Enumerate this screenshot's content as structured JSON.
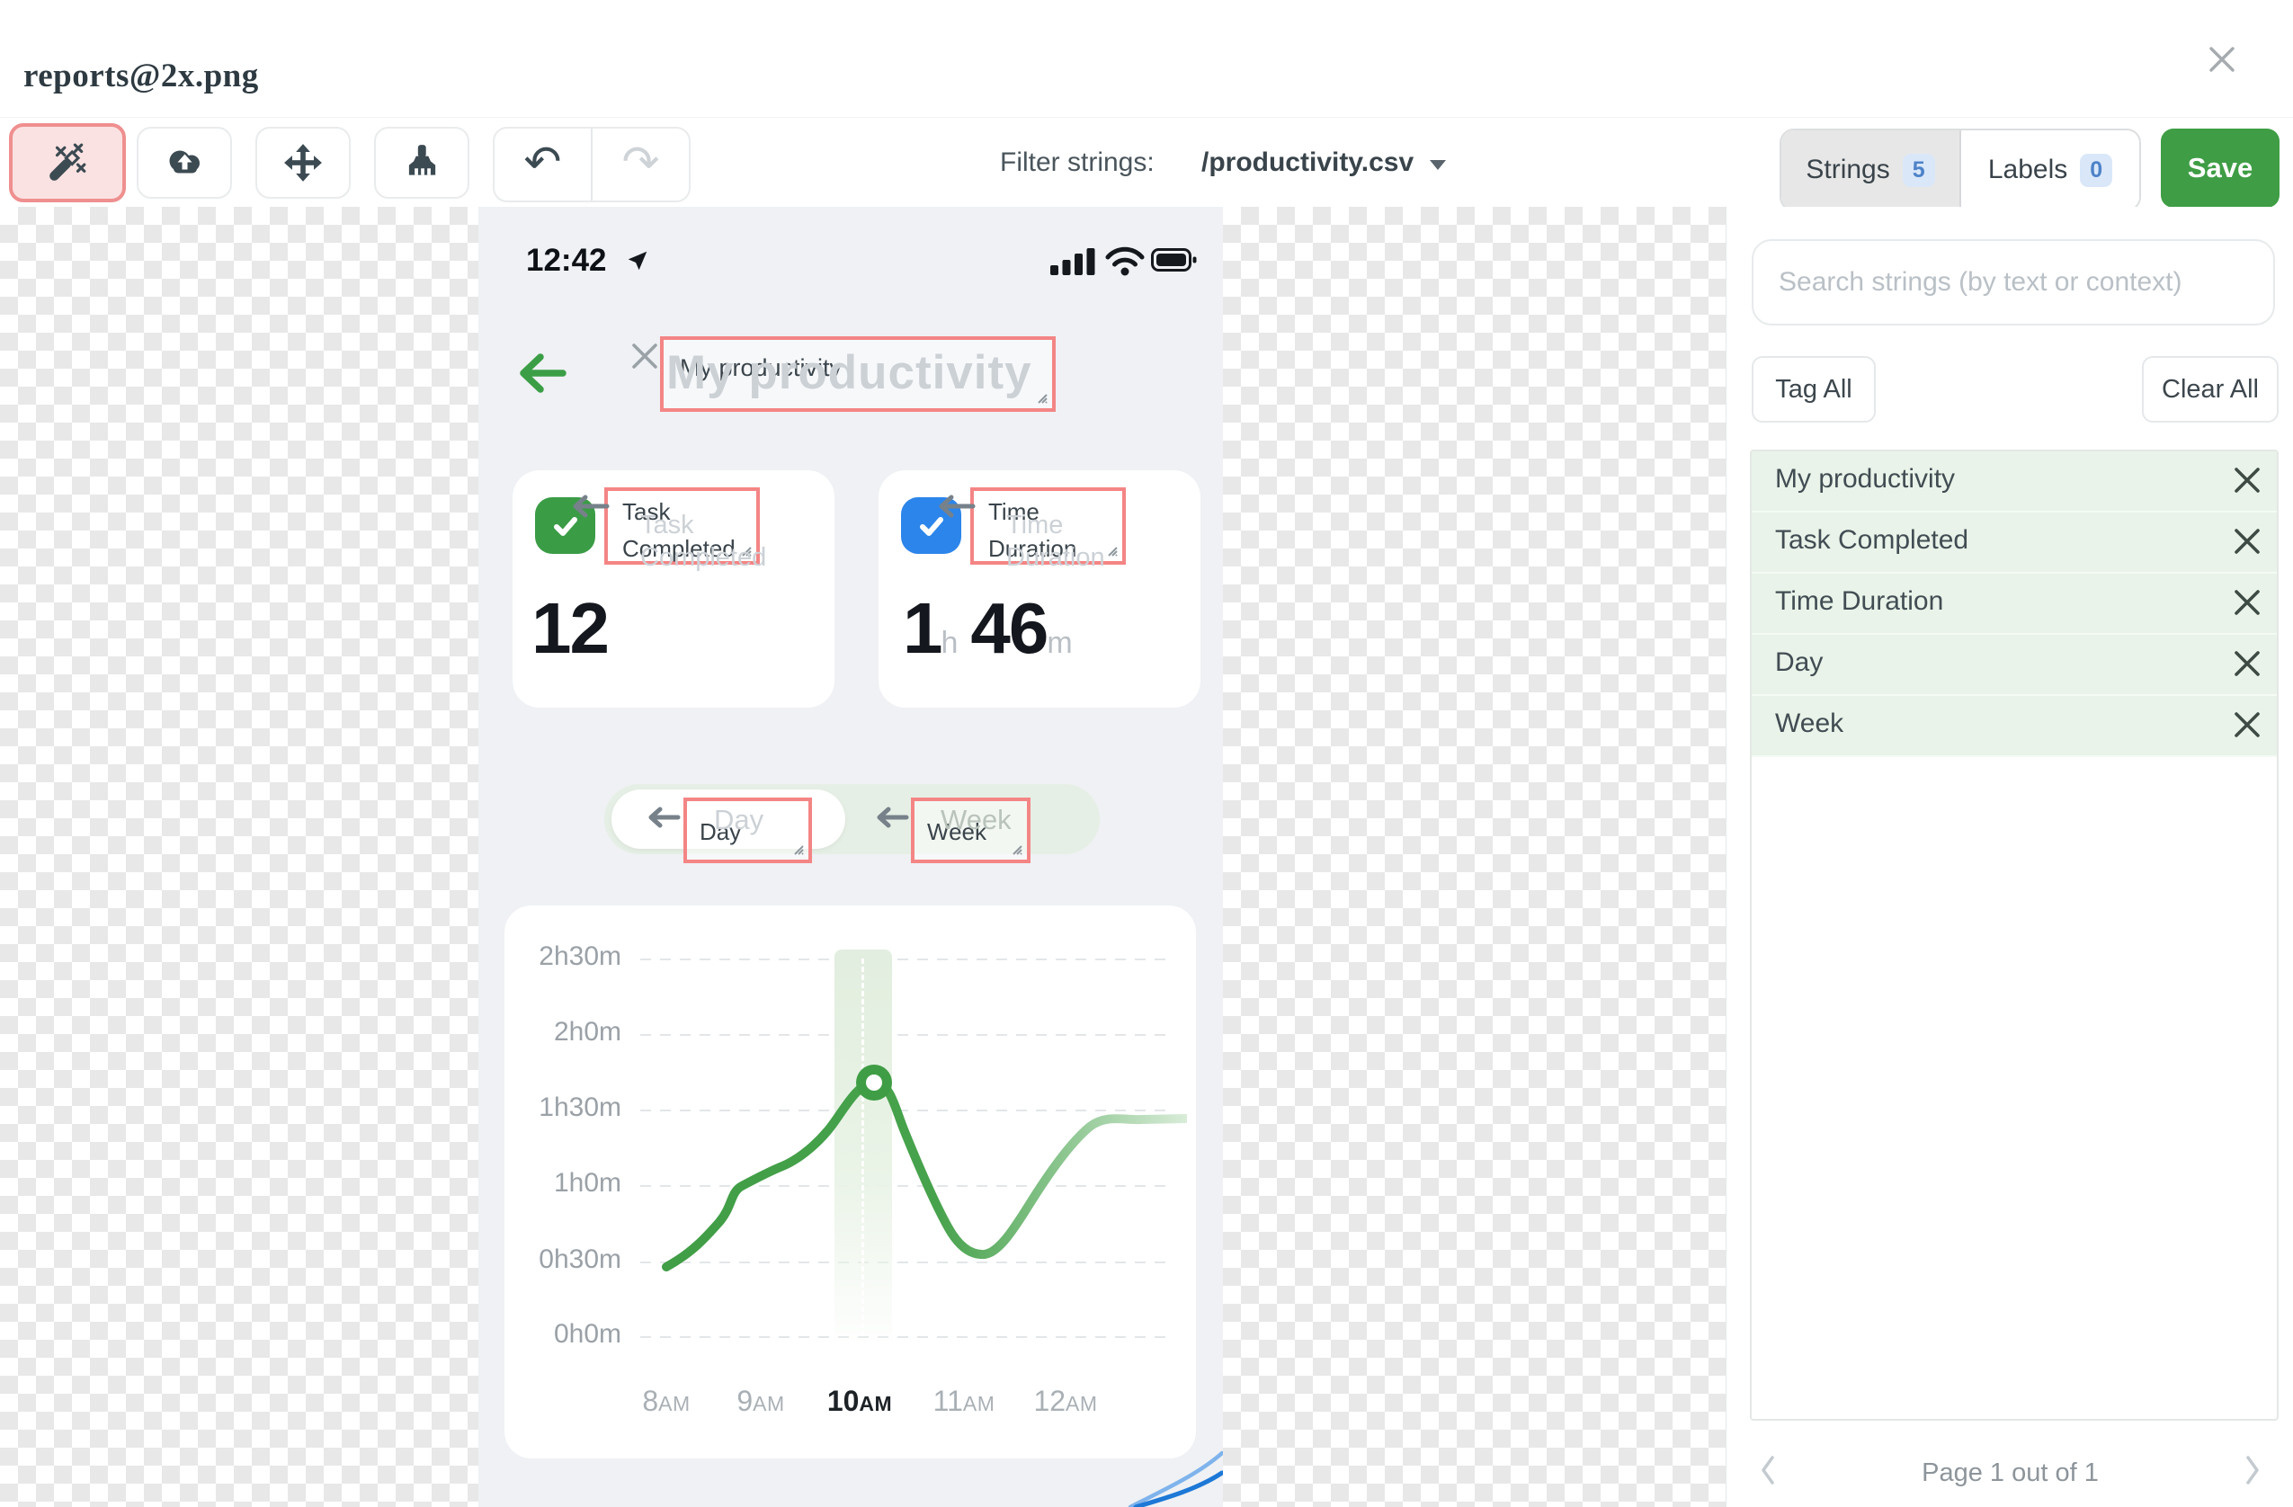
{
  "window": {
    "title": "reports@2x.png"
  },
  "toolbar": {
    "tools": [
      "magic-wand",
      "upload",
      "move",
      "brush",
      "undo",
      "redo"
    ],
    "filter_label": "Filter strings:",
    "filter_value": "/productivity.csv"
  },
  "tabs": {
    "strings_label": "Strings",
    "strings_count": "5",
    "labels_label": "Labels",
    "labels_count": "0",
    "save_label": "Save"
  },
  "sidebar": {
    "search_placeholder": "Search strings (by text or context)",
    "tag_all_label": "Tag All",
    "clear_all_label": "Clear All",
    "strings": [
      "My productivity",
      "Task Completed",
      "Time Duration",
      "Day",
      "Week"
    ],
    "pagination_label": "Page 1 out of 1"
  },
  "phone": {
    "status_time": "12:42",
    "app_title": "My productivity",
    "cards": [
      {
        "label_lines": [
          "Task",
          "Completed"
        ],
        "value": "12"
      },
      {
        "label_lines": [
          "Time",
          "Duration"
        ],
        "value_h": "1",
        "unit_h": "h",
        "value_m": "46",
        "unit_m": "m"
      }
    ],
    "toggle": {
      "day": "Day",
      "week": "Week"
    }
  },
  "annotations": {
    "title": "My productivity",
    "card1_lines": [
      "Task",
      "Completed"
    ],
    "card2_lines": [
      "Time",
      "Duration"
    ],
    "day": "Day",
    "week": "Week"
  },
  "colors": {
    "accent_green": "#3f9d45",
    "accent_blue": "#2c85ea",
    "annotation_red": "#f48585",
    "row_green": "#e9f3e9",
    "badge_blue": "#d9e7f9"
  },
  "chart_data": {
    "type": "line",
    "title": "",
    "x_labels": [
      "8AM",
      "9AM",
      "10AM",
      "11AM",
      "12AM"
    ],
    "x_label_parts": [
      [
        "8",
        "AM"
      ],
      [
        "9",
        "AM"
      ],
      [
        "10",
        "AM"
      ],
      [
        "11",
        "AM"
      ],
      [
        "12",
        "AM"
      ]
    ],
    "selected_x": "10AM",
    "y_ticks_desc": [
      "2h30m",
      "2h0m",
      "1h30m",
      "1h0m",
      "0h30m",
      "0h0m"
    ],
    "ylim_minutes": [
      0,
      150
    ],
    "grid": "horizontal-dashed",
    "legend": "none",
    "series": [
      {
        "name": "Time Duration",
        "unit": "minutes",
        "x": [
          "8:00",
          "8:30",
          "9:00",
          "9:30",
          "10:00",
          "10:30",
          "11:00",
          "11:30",
          "12:00"
        ],
        "values": [
          28,
          43,
          66,
          75,
          101,
          63,
          35,
          45,
          85
        ]
      }
    ],
    "highlight_point": {
      "x": "10:00",
      "value_minutes": 101
    }
  }
}
